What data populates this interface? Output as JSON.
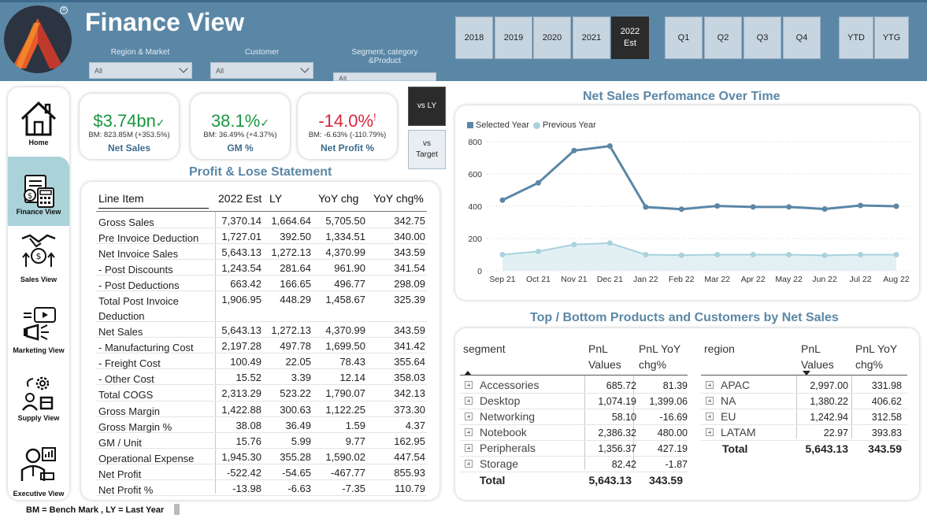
{
  "app": {
    "title": "Finance View"
  },
  "slicers": [
    {
      "label": "Region & Market",
      "value": "All"
    },
    {
      "label": "Customer",
      "value": "All"
    },
    {
      "label": "Segment, category\n&Product",
      "value": "All"
    }
  ],
  "periods": {
    "years": [
      "2018",
      "2019",
      "2020",
      "2021",
      "2022\nEst"
    ],
    "quarters": [
      "Q1",
      "Q2",
      "Q3",
      "Q4"
    ],
    "ytd": "YTD",
    "ytg": "YTG",
    "selected": "2022\nEst"
  },
  "nav": [
    {
      "label": "Home",
      "icon": "home-icon"
    },
    {
      "label": "Finance View",
      "icon": "finance-calculator-icon",
      "active": true
    },
    {
      "label": "Sales View",
      "icon": "sales-handshake-icon"
    },
    {
      "label": "Marketing View",
      "icon": "megaphone-icon"
    },
    {
      "label": "Supply View",
      "icon": "supply-chain-icon"
    },
    {
      "label": "Executive View",
      "icon": "executive-icon"
    }
  ],
  "kpis": [
    {
      "value": "$3.74bn",
      "mark": "✓",
      "bm": "BM: 823.85M (+353.5%)",
      "name": "Net Sales",
      "color": "#1a9641"
    },
    {
      "value": "38.1%",
      "mark": "✓",
      "bm": "BM: 36.49% (+4.37%)",
      "name": "GM %",
      "color": "#1a9641"
    },
    {
      "value": "-14.0%",
      "mark": "!",
      "bm": "BM: -6.63% (-110.79%)",
      "name": "Net Profit %",
      "color": "#d7263d"
    }
  ],
  "toggles": {
    "vs_ly": "vs LY",
    "vs_target": "vs\nTarget"
  },
  "pnl": {
    "title": "Profit & Lose Statement",
    "headers": [
      "Line Item",
      "2022 Est",
      "LY",
      "YoY chg",
      "YoY chg%"
    ],
    "rows": [
      [
        "Gross Sales",
        "7,370.14",
        "1,664.64",
        "5,705.50",
        "342.75"
      ],
      [
        "Pre Invoice Deduction",
        "1,727.01",
        "392.50",
        "1,334.51",
        "340.00"
      ],
      [
        "Net Invoice Sales",
        "5,643.13",
        "1,272.13",
        "4,370.99",
        "343.59"
      ],
      [
        " - Post Discounts",
        "1,243.54",
        "281.64",
        "961.90",
        "341.54"
      ],
      [
        " - Post Deductions",
        "663.42",
        "166.65",
        "496.77",
        "298.09"
      ],
      [
        "Total Post Invoice Deduction",
        "1,906.95",
        "448.29",
        "1,458.67",
        "325.39"
      ],
      [
        "Net Sales",
        "5,643.13",
        "1,272.13",
        "4,370.99",
        "343.59"
      ],
      [
        " - Manufacturing Cost",
        "2,197.28",
        "497.78",
        "1,699.50",
        "341.42"
      ],
      [
        " - Freight Cost",
        "100.49",
        "22.05",
        "78.43",
        "355.64"
      ],
      [
        " - Other Cost",
        "15.52",
        "3.39",
        "12.14",
        "358.03"
      ],
      [
        "Total COGS",
        "2,313.29",
        "523.22",
        "1,790.07",
        "342.13"
      ],
      [
        "Gross Margin",
        "1,422.88",
        "300.63",
        "1,122.25",
        "373.30"
      ],
      [
        "Gross Margin %",
        "38.08",
        "36.49",
        "1.59",
        "4.37"
      ],
      [
        "GM / Unit",
        "15.76",
        "5.99",
        "9.77",
        "162.95"
      ],
      [
        "Operational Expense",
        "1,945.30",
        "355.28",
        "1,590.02",
        "447.54"
      ],
      [
        "Net Profit",
        "-522.42",
        "-54.65",
        "-467.77",
        "855.93"
      ],
      [
        "Net Profit %",
        "-13.98",
        "-6.63",
        "-7.35",
        "110.79"
      ]
    ]
  },
  "chart_data": {
    "type": "line",
    "title": "Net Sales Perfomance Over Time",
    "categories": [
      "Sep 21",
      "Oct 21",
      "Nov 21",
      "Dec 21",
      "Jan 22",
      "Feb 22",
      "Mar 22",
      "Apr 22",
      "May 22",
      "Jun 22",
      "Jul 22",
      "Aug 22"
    ],
    "series": [
      {
        "name": "Selected Year",
        "values": [
          438,
          545,
          745,
          773,
          395,
          382,
          402,
          396,
          396,
          383,
          405,
          400
        ],
        "color": "#5b87a6"
      },
      {
        "name": "Previous Year",
        "values": [
          100,
          120,
          163,
          172,
          100,
          97,
          100,
          100,
          100,
          96,
          100,
          100
        ],
        "color": "#a9d2df"
      }
    ],
    "ylim": [
      0,
      800
    ],
    "yticks": [
      "0",
      "200",
      "400",
      "600",
      "800"
    ],
    "legend": "top-left",
    "grid": true
  },
  "top_bottom": {
    "title": "Top / Bottom Products and Customers by Net Sales",
    "segment": {
      "headers": [
        "segment",
        "PnL\nValues",
        "PnL YoY\nchg%"
      ],
      "rows": [
        [
          "Accessories",
          "685.72",
          "81.39"
        ],
        [
          "Desktop",
          "1,074.19",
          "1,399.06"
        ],
        [
          "Networking",
          "58.10",
          "-16.69"
        ],
        [
          "Notebook",
          "2,386.32",
          "480.00"
        ],
        [
          "Peripherals",
          "1,356.37",
          "427.19"
        ],
        [
          "Storage",
          "82.42",
          "-1.87"
        ]
      ],
      "total": [
        "Total",
        "5,643.13",
        "343.59"
      ]
    },
    "region": {
      "headers": [
        "region",
        "PnL\nValues",
        "PnL YoY\nchg%"
      ],
      "rows": [
        [
          "APAC",
          "2,997.00",
          "331.98"
        ],
        [
          "NA",
          "1,380.22",
          "406.62"
        ],
        [
          "EU",
          "1,242.94",
          "312.58"
        ],
        [
          "LATAM",
          "22.97",
          "393.83"
        ]
      ],
      "total": [
        "Total",
        "5,643.13",
        "343.59"
      ]
    }
  },
  "footer": {
    "note": "BM = Bench Mark , LY = Last Year"
  }
}
